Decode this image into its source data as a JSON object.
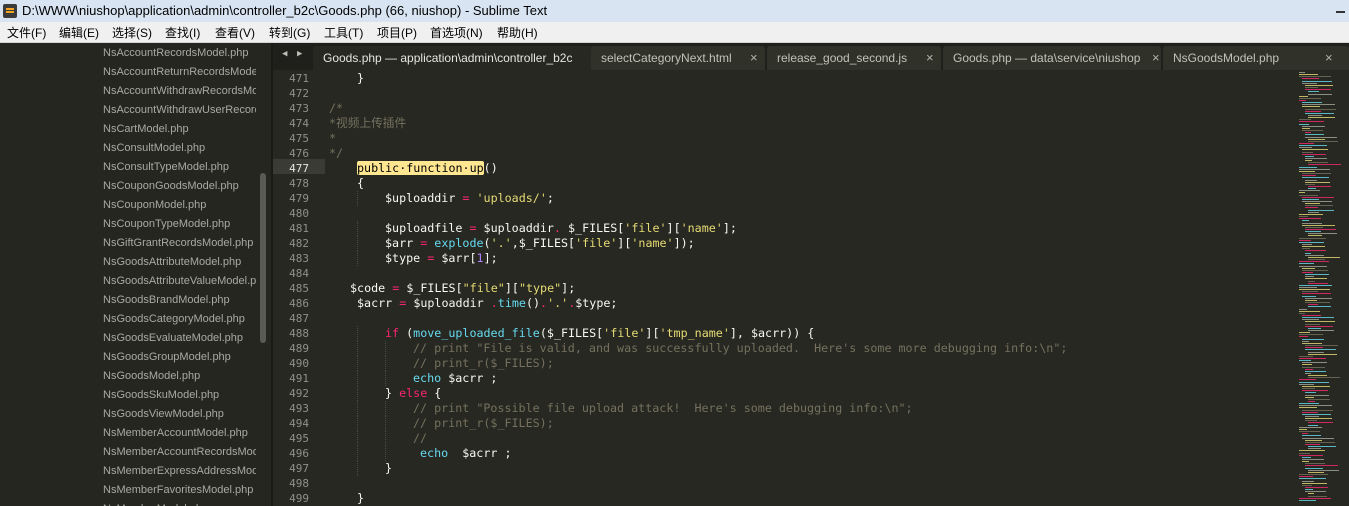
{
  "window": {
    "title": "D:\\WWW\\niushop\\application\\admin\\controller_b2c\\Goods.php (66, niushop) - Sublime Text"
  },
  "menu": [
    "文件(F)",
    "编辑(E)",
    "选择(S)",
    "查找(I)",
    "查看(V)",
    "转到(G)",
    "工具(T)",
    "项目(P)",
    "首选项(N)",
    "帮助(H)"
  ],
  "sidebar": {
    "files": [
      "NsAccountRecordsModel.php",
      "NsAccountReturnRecordsModel.php",
      "NsAccountWithdrawRecordsModel.php",
      "NsAccountWithdrawUserRecordsModel.php",
      "NsCartModel.php",
      "NsConsultModel.php",
      "NsConsultTypeModel.php",
      "NsCouponGoodsModel.php",
      "NsCouponModel.php",
      "NsCouponTypeModel.php",
      "NsGiftGrantRecordsModel.php",
      "NsGoodsAttributeModel.php",
      "NsGoodsAttributeValueModel.php",
      "NsGoodsBrandModel.php",
      "NsGoodsCategoryModel.php",
      "NsGoodsEvaluateModel.php",
      "NsGoodsGroupModel.php",
      "NsGoodsModel.php",
      "NsGoodsSkuModel.php",
      "NsGoodsViewModel.php",
      "NsMemberAccountModel.php",
      "NsMemberAccountRecordsModel.php",
      "NsMemberExpressAddressModel.php",
      "NsMemberFavoritesModel.php",
      "NsMemberModel.php"
    ]
  },
  "tabs": {
    "nav_left": "◀",
    "nav_right": "▶",
    "close_glyph": "×",
    "items": [
      {
        "label": "Goods.php — application\\admin\\controller_b2c",
        "active": true
      },
      {
        "label": "selectCategoryNext.html",
        "active": false
      },
      {
        "label": "release_good_second.js",
        "active": false
      },
      {
        "label": "Goods.php — data\\service\\niushop",
        "active": false
      },
      {
        "label": "NsGoodsModel.php",
        "active": false
      }
    ]
  },
  "editor": {
    "current_line": 477,
    "lines": [
      {
        "n": 471,
        "ind": 1,
        "toks": [
          [
            "p",
            "}"
          ]
        ]
      },
      {
        "n": 472,
        "ind": 0,
        "toks": []
      },
      {
        "n": 473,
        "ind": 0,
        "toks": [
          [
            "c",
            "/*"
          ]
        ]
      },
      {
        "n": 474,
        "ind": 0,
        "toks": [
          [
            "c",
            "*视频上传插件"
          ]
        ]
      },
      {
        "n": 475,
        "ind": 0,
        "toks": [
          [
            "c",
            "*"
          ]
        ]
      },
      {
        "n": 476,
        "ind": 0,
        "toks": [
          [
            "c",
            "*/"
          ]
        ]
      },
      {
        "n": 477,
        "ind": 1,
        "toks": [
          [
            "h",
            "public·function·up"
          ],
          [
            "p",
            "()"
          ]
        ]
      },
      {
        "n": 478,
        "ind": 1,
        "toks": [
          [
            "p",
            "{"
          ]
        ]
      },
      {
        "n": 479,
        "ind": 2,
        "toks": [
          [
            "p",
            "$uploaddir "
          ],
          [
            "k",
            "="
          ],
          [
            "p",
            " "
          ],
          [
            "s",
            "'uploads/'"
          ],
          [
            "p",
            ";"
          ]
        ]
      },
      {
        "n": 480,
        "ind": 0,
        "toks": []
      },
      {
        "n": 481,
        "ind": 2,
        "toks": [
          [
            "p",
            "$uploadfile "
          ],
          [
            "k",
            "="
          ],
          [
            "p",
            " $uploaddir"
          ],
          [
            "k",
            "."
          ],
          [
            "p",
            " $_FILES["
          ],
          [
            "s",
            "'file'"
          ],
          [
            "p",
            "]["
          ],
          [
            "s",
            "'name'"
          ],
          [
            "p",
            "];"
          ]
        ]
      },
      {
        "n": 482,
        "ind": 2,
        "toks": [
          [
            "p",
            "$arr "
          ],
          [
            "k",
            "="
          ],
          [
            "p",
            " "
          ],
          [
            "f",
            "explode"
          ],
          [
            "p",
            "("
          ],
          [
            "s",
            "'.'"
          ],
          [
            "p",
            ",$_FILES["
          ],
          [
            "s",
            "'file'"
          ],
          [
            "p",
            "]["
          ],
          [
            "s",
            "'name'"
          ],
          [
            "p",
            "]);"
          ]
        ]
      },
      {
        "n": 483,
        "ind": 2,
        "toks": [
          [
            "p",
            "$type "
          ],
          [
            "k",
            "="
          ],
          [
            "p",
            " $arr["
          ],
          [
            "n",
            "1"
          ],
          [
            "p",
            "];"
          ]
        ]
      },
      {
        "n": 484,
        "ind": 0,
        "toks": []
      },
      {
        "n": 485,
        "ind": 0,
        "lead": "   ",
        "toks": [
          [
            "p",
            "$code "
          ],
          [
            "k",
            "="
          ],
          [
            "p",
            " $_FILES["
          ],
          [
            "s",
            "\"file\""
          ],
          [
            "p",
            "]["
          ],
          [
            "s",
            "\"type\""
          ],
          [
            "p",
            "];"
          ]
        ]
      },
      {
        "n": 486,
        "ind": 0,
        "lead": "    ",
        "toks": [
          [
            "p",
            "$acrr "
          ],
          [
            "k",
            "="
          ],
          [
            "p",
            " $uploaddir "
          ],
          [
            "k",
            "."
          ],
          [
            "f",
            "time"
          ],
          [
            "p",
            "()"
          ],
          [
            "k",
            "."
          ],
          [
            "s",
            "'.'"
          ],
          [
            "k",
            "."
          ],
          [
            "p",
            "$type;"
          ]
        ]
      },
      {
        "n": 487,
        "ind": 0,
        "toks": []
      },
      {
        "n": 488,
        "ind": 2,
        "toks": [
          [
            "k",
            "if"
          ],
          [
            "p",
            " ("
          ],
          [
            "f",
            "move_uploaded_file"
          ],
          [
            "p",
            "($_FILES["
          ],
          [
            "s",
            "'file'"
          ],
          [
            "p",
            "]["
          ],
          [
            "s",
            "'tmp_name'"
          ],
          [
            "p",
            "], $acrr)) {"
          ]
        ]
      },
      {
        "n": 489,
        "ind": 3,
        "toks": [
          [
            "c",
            "// print \"File is valid, and was successfully uploaded.  Here's some more debugging info:\\n\";"
          ]
        ]
      },
      {
        "n": 490,
        "ind": 3,
        "toks": [
          [
            "c",
            "// print_r($_FILES);"
          ]
        ]
      },
      {
        "n": 491,
        "ind": 3,
        "toks": [
          [
            "f",
            "echo"
          ],
          [
            "p",
            " $acrr ;"
          ]
        ]
      },
      {
        "n": 492,
        "ind": 2,
        "toks": [
          [
            "p",
            "} "
          ],
          [
            "k",
            "else"
          ],
          [
            "p",
            " {"
          ]
        ]
      },
      {
        "n": 493,
        "ind": 3,
        "toks": [
          [
            "c",
            "// print \"Possible file upload attack!  Here's some debugging info:\\n\";"
          ]
        ]
      },
      {
        "n": 494,
        "ind": 3,
        "toks": [
          [
            "c",
            "// print_r($_FILES);"
          ]
        ]
      },
      {
        "n": 495,
        "ind": 3,
        "toks": [
          [
            "c",
            "//"
          ]
        ]
      },
      {
        "n": 496,
        "ind": 3,
        "lead": " ",
        "toks": [
          [
            "f",
            "echo"
          ],
          [
            "p",
            "  $acrr ;"
          ]
        ]
      },
      {
        "n": 497,
        "ind": 2,
        "toks": [
          [
            "p",
            "}"
          ]
        ]
      },
      {
        "n": 498,
        "ind": 0,
        "toks": []
      },
      {
        "n": 499,
        "ind": 1,
        "toks": [
          [
            "p",
            "}"
          ]
        ]
      }
    ]
  },
  "colors": {
    "background": "#272822",
    "keyword": "#f92672",
    "string": "#e6db74",
    "function": "#66d9ef",
    "comment": "#75715e",
    "number": "#ae81ff",
    "highlight": "#ffe792"
  }
}
